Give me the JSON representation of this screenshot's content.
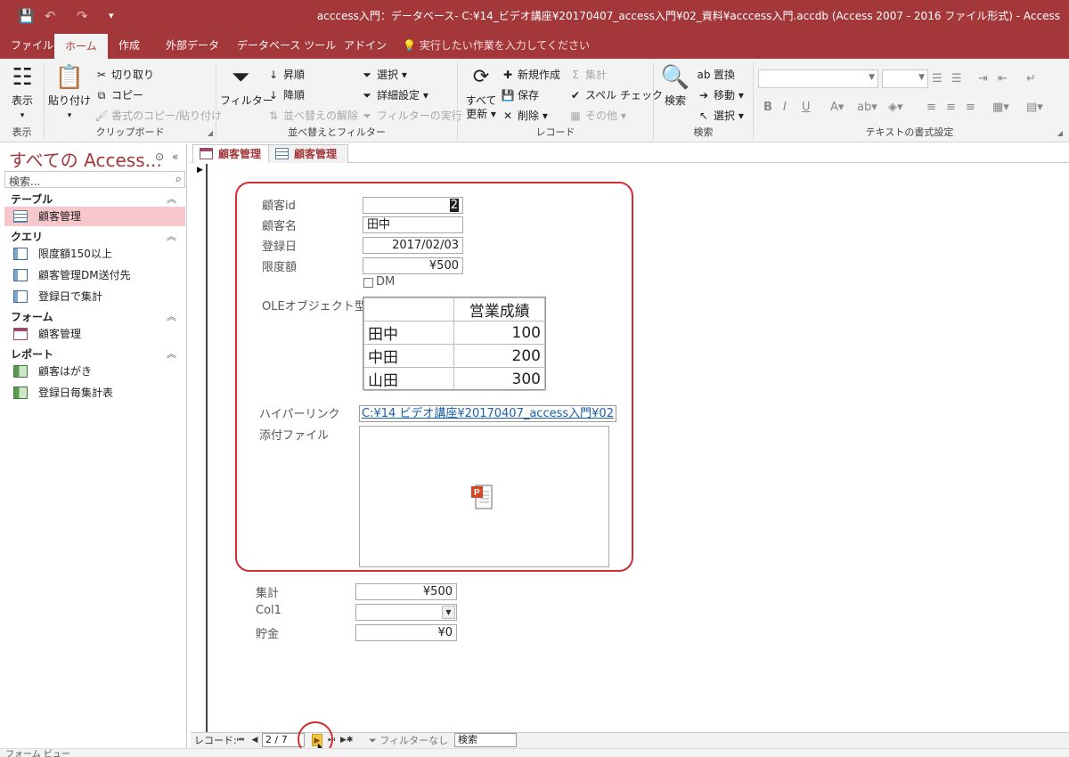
{
  "titlebar": {
    "title": "acccess入門：データベース- C:¥14_ビデオ講座¥20170407_access入門¥02_資料¥acccess入門.accdb (Access 2007 - 2016 ファイル形式)  -  Access",
    "save_icon": "💾",
    "undo_icon": "↶",
    "redo_icon": "↷",
    "customize_icon": "▾"
  },
  "ribbon_tabs": [
    "ファイル",
    "ホーム",
    "作成",
    "外部データ",
    "データベース ツール",
    "アドイン"
  ],
  "tell_me": "実行したい作業を入力してください",
  "ribbon": {
    "view": {
      "label": "表示",
      "group": "表示"
    },
    "clipboard": {
      "paste": "貼り付け",
      "cut": "切り取り",
      "copy": "コピー",
      "format_painter": "書式のコピー/貼り付け",
      "group": "クリップボード"
    },
    "sort_filter": {
      "filter": "フィルター",
      "ascending": "昇順",
      "descending": "降順",
      "remove_sort": "並べ替えの解除",
      "selection": "選択",
      "advanced": "詳細設定",
      "toggle_filter": "フィルターの実行",
      "group": "並べ替えとフィルター"
    },
    "records": {
      "refresh_line1": "すべて",
      "refresh_line2": "更新",
      "new": "新規作成",
      "save": "保存",
      "delete": "削除",
      "totals": "集計",
      "spelling": "スペル チェック",
      "more": "その他",
      "group": "レコード"
    },
    "find": {
      "find": "検索",
      "replace": "置換",
      "goto": "移動",
      "select": "選択",
      "group": "検索"
    },
    "text_format": {
      "bold": "B",
      "italic": "I",
      "underline": "U",
      "group": "テキストの書式設定"
    }
  },
  "nav": {
    "title": "すべての Access...",
    "search_placeholder": "検索...",
    "groups": [
      {
        "label": "テーブル",
        "items": [
          "顧客管理"
        ]
      },
      {
        "label": "クエリ",
        "items": [
          "限度額150以上",
          "顧客管理DM送付先",
          "登録日で集計"
        ]
      },
      {
        "label": "フォーム",
        "items": [
          "顧客管理"
        ]
      },
      {
        "label": "レポート",
        "items": [
          "顧客はがき",
          "登録日毎集計表"
        ]
      }
    ]
  },
  "doc_tabs": [
    "顧客管理",
    "顧客管理"
  ],
  "form": {
    "labels": {
      "id": "顧客id",
      "name": "顧客名",
      "date": "登録日",
      "limit": "限度額",
      "dm": "DM",
      "ole": "OLEオブジェクト型",
      "hyperlink": "ハイパーリンク",
      "attachment": "添付ファイル",
      "total": "集計",
      "col1": "Col1",
      "savings": "貯金"
    },
    "values": {
      "id": "2",
      "name": "田中",
      "date": "2017/02/03",
      "limit": "¥500",
      "hyperlink": "C:¥14 ビデオ講座¥20170407_access入門¥02",
      "total": "¥500",
      "col1": "",
      "savings": "¥0"
    },
    "ole_table": {
      "header": "営業成績",
      "rows": [
        {
          "name": "田中",
          "value": "100"
        },
        {
          "name": "中田",
          "value": "200"
        },
        {
          "name": "山田",
          "value": "300"
        }
      ]
    }
  },
  "record_nav": {
    "label": "レコード:",
    "position": "2 / 7",
    "filter": "フィルターなし",
    "search": "検索"
  },
  "status": {
    "view": "フォーム ビュー"
  },
  "colors": {
    "accent": "#a4373a",
    "highlight": "#d12d32"
  }
}
